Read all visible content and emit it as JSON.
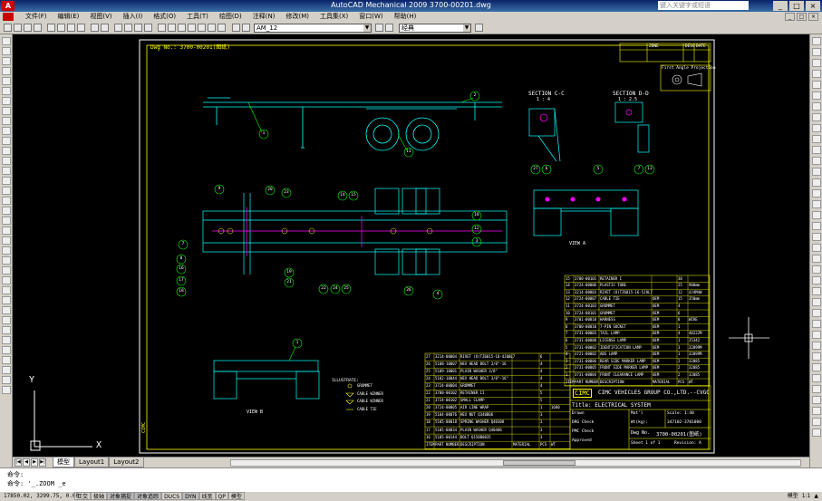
{
  "titlebar": {
    "app_logo": "A",
    "title": "AutoCAD Mechanical 2009  3700-00201.dwg",
    "search_placeholder": "键入关键字或短语",
    "minimize": "_",
    "restore": "□",
    "close": "×"
  },
  "menu": {
    "items": [
      "文件(F)",
      "编辑(E)",
      "视图(V)",
      "插入(I)",
      "格式(O)",
      "工具(T)",
      "绘图(D)",
      "注释(N)",
      "修改(M)",
      "工具集(X)",
      "窗口(W)",
      "帮助(H)"
    ]
  },
  "toolbar": {
    "layer_dropdown": "AM_12",
    "style_dropdown": "经典"
  },
  "drawing": {
    "dwg_no": "Dwg No.: 3700-00201(图纸)",
    "section_cc": "SECTION C-C",
    "section_cc_scale": "1 : 4",
    "section_dd": "SECTION D-D",
    "section_dd_scale": "1 : 2.5",
    "first_angle": "First Angle Projection",
    "view_a": "VIEW A",
    "view_b": "VIEW B",
    "cimc_side": "CIMC",
    "legend": {
      "title": "ILLUSTRATE:",
      "items": [
        "GROMMET",
        "CABLE WINNER",
        "CABLE WINNER",
        "CABLE TIE"
      ]
    },
    "title_block": {
      "company": "CIMC VEHICLES GROUP CO.,LTD.--CVGC",
      "title": "Title:  ELECTRICAL SYSTEM",
      "logo": "CIMC",
      "drawn": "Drawn",
      "drg_check": "DRG Check",
      "pmc_check": "PMC Check",
      "approved": "Approved",
      "mat": "Mat'l",
      "scale": "Scale: 1:40",
      "wt": "Wt(kg):",
      "wt_value": "347102-3701000",
      "dwg_no_label": "Dwg No.",
      "dwg_no_value": "3700-00201(图纸)",
      "sheet": "Sheet  1  of  1",
      "revision": "Revision: A"
    },
    "revision_header": [
      "ZONE",
      "DESC",
      "DATE"
    ],
    "bom_left": [
      [
        "27",
        "3214-00004",
        "RIVET (O)TZ6015-18-4J00L7",
        "",
        "6",
        ""
      ],
      [
        "26",
        "5108-10007",
        "HEX HEAD BOLT 3/8\"-16",
        "",
        "4",
        ""
      ],
      [
        "25",
        "5109-10001",
        "PLAIN WASHER 3/8\"",
        "",
        "4",
        ""
      ],
      [
        "24",
        "5102-10044",
        "HEX HEAD BOLT 3/8\"-16\"",
        "",
        "4",
        ""
      ],
      [
        "23",
        "3724-00004",
        "GROMMET",
        "",
        "4",
        ""
      ],
      [
        "22",
        "3700-00102",
        "RETAINER II",
        "",
        "5",
        ""
      ],
      [
        "21",
        "3724-00102",
        "SMALL CLAMP",
        "",
        "5",
        ""
      ],
      [
        "20",
        "3724-00005",
        "AIR LINE WRAP",
        "",
        "1",
        "1600"
      ],
      [
        "19",
        "5104-00076",
        "HEX NUT Q340B06",
        "",
        "3",
        ""
      ],
      [
        "18",
        "5105-00018",
        "SPRING WASHER Q40308",
        "",
        "3",
        ""
      ],
      [
        "17",
        "5105-00034",
        "PLAIN WASHER Q40406",
        "",
        "3",
        ""
      ],
      [
        "16",
        "5105-00144",
        "BOLT Q150B0835",
        "",
        "3",
        ""
      ]
    ],
    "bom_left_header": [
      "ITEM",
      "PART NUMBER",
      "DESCRIPTION",
      "MATERIAL",
      "PCS",
      "WT"
    ],
    "bom_right": [
      [
        "15",
        "3700-00101",
        "RETAINER I",
        "",
        "30",
        ""
      ],
      [
        "14",
        "3724-00006",
        "PLASTIC TUBE",
        "",
        "25",
        "900mm"
      ],
      [
        "13",
        "3214-00003",
        "RIVET (O)TZ6015-16-5J8L7",
        "",
        "12",
        "4J4M4W"
      ],
      [
        "12",
        "3724-00007",
        "CABLE TIE",
        "OEM",
        "15",
        "350mm"
      ],
      [
        "11",
        "3724-00103",
        "GROMMET",
        "OEM",
        "4",
        ""
      ],
      [
        "10",
        "3724-00101",
        "GROMMET",
        "OEM",
        "6",
        ""
      ],
      [
        "9",
        "3701-00018",
        "HARNESS",
        "OEM",
        "0",
        "WIRE"
      ],
      [
        "8",
        "3700-00010",
        "7-PIN SOCKET",
        "OEM",
        "1",
        ""
      ],
      [
        "7",
        "3731-00003",
        "TAIL LAMP",
        "OEM",
        "4",
        "40222M"
      ],
      [
        "6",
        "3731-00008",
        "LICENSE LAMP",
        "OEM",
        "1",
        "25342"
      ],
      [
        "5",
        "3731-00002",
        "IDENTIFICATION LAMP",
        "OEM",
        "3",
        "32099M"
      ],
      [
        "4",
        "3721-00002",
        "ABS LAMP",
        "OEM",
        "1",
        "32099M"
      ],
      [
        "3",
        "3731-00006",
        "REAR SIDE MARKER LAMP",
        "OEM",
        "2",
        "32085"
      ],
      [
        "2",
        "3731-00005",
        "FRONT SIDE MARKER LAMP",
        "OEM",
        "2",
        "32085"
      ],
      [
        "1",
        "3731-00004",
        "FRONT CLEARANCE LAMP",
        "OEM",
        "2",
        "32085"
      ]
    ],
    "bom_right_header": [
      "ITEM",
      "PART NUMBER",
      "DESCRIPTION",
      "MATERIAL",
      "PCS",
      "WT"
    ],
    "balloons_top": [
      "1",
      "2",
      "11"
    ],
    "balloons_plan": [
      "9",
      "20",
      "23",
      "14",
      "15",
      "10",
      "12",
      "3",
      "7",
      "8",
      "16",
      "17",
      "18",
      "19",
      "21",
      "22",
      "24",
      "25",
      "26",
      "4"
    ],
    "balloons_rear": [
      "27",
      "6",
      "5",
      "7",
      "13"
    ],
    "balloon_bottom": "1"
  },
  "layout_tabs": {
    "model": "模型",
    "layout1": "Layout1",
    "layout2": "Layout2"
  },
  "command": {
    "line1": "命令:",
    "line2": "命令: '_.ZOOM _e"
  },
  "status": {
    "coords": "17850.02, 3299.75, 0.00",
    "modes": [
      "正交",
      "极轴",
      "对象捕捉",
      "对象追踪",
      "DUCS",
      "DYN",
      "线宽",
      "QP",
      "模型"
    ],
    "modes_on": [
      false,
      false,
      true,
      true,
      false,
      true,
      false,
      false,
      false
    ],
    "right_items": [
      "模型",
      "1:1",
      "▲"
    ]
  }
}
